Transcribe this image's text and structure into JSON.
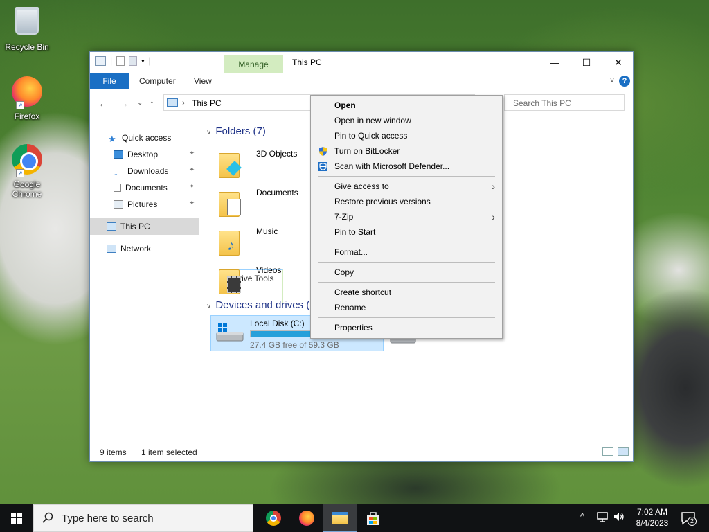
{
  "desktop": {
    "icons": [
      {
        "label": "Recycle Bin",
        "icon": "recycle-bin-icon"
      },
      {
        "label": "Firefox",
        "icon": "firefox-icon"
      },
      {
        "label": "Google Chrome",
        "icon": "chrome-icon"
      }
    ]
  },
  "window": {
    "title": "This PC",
    "context_tab": "Manage",
    "ribbon_tabs": [
      "File",
      "Computer",
      "View",
      "Drive Tools"
    ],
    "controls": {
      "minimize": "—",
      "maximize": "☐",
      "close": "✕"
    },
    "help": "?"
  },
  "address": {
    "crumb": "This PC",
    "separator": "›",
    "search_placeholder": "Search This PC"
  },
  "navpane": {
    "items": [
      {
        "label": "Quick access",
        "icon": "star-icon",
        "pinned": false
      },
      {
        "label": "Desktop",
        "icon": "desktop-folder-icon",
        "pinned": true
      },
      {
        "label": "Downloads",
        "icon": "download-arrow-icon",
        "pinned": true
      },
      {
        "label": "Documents",
        "icon": "document-icon",
        "pinned": true
      },
      {
        "label": "Pictures",
        "icon": "picture-icon",
        "pinned": true
      },
      {
        "label": "This PC",
        "icon": "computer-icon",
        "pinned": false,
        "selected": true
      },
      {
        "label": "Network",
        "icon": "network-icon",
        "pinned": false
      }
    ],
    "pin_glyph": "📌"
  },
  "content": {
    "folders_header": "Folders (7)",
    "folders": [
      "3D Objects",
      "Documents",
      "Music",
      "Videos"
    ],
    "drives_header": "Devices and drives (2",
    "drive": {
      "name": "Local Disk (C:)",
      "free_text": "27.4 GB free of 59.3 GB",
      "used_fraction": 0.54
    }
  },
  "status": {
    "items": "9 items",
    "selected": "1 item selected"
  },
  "context_menu": {
    "groups": [
      [
        {
          "label": "Open",
          "bold": true
        },
        {
          "label": "Open in new window"
        },
        {
          "label": "Pin to Quick access"
        },
        {
          "label": "Turn on BitLocker",
          "icon": "uac-shield-icon"
        },
        {
          "label": "Scan with Microsoft Defender...",
          "icon": "defender-icon"
        }
      ],
      [
        {
          "label": "Give access to",
          "submenu": true
        },
        {
          "label": "Restore previous versions"
        },
        {
          "label": "7-Zip",
          "submenu": true
        },
        {
          "label": "Pin to Start"
        }
      ],
      [
        {
          "label": "Format..."
        }
      ],
      [
        {
          "label": "Copy"
        }
      ],
      [
        {
          "label": "Create shortcut"
        },
        {
          "label": "Rename"
        }
      ],
      [
        {
          "label": "Properties"
        }
      ]
    ],
    "submenu_glyph": "›"
  },
  "taskbar": {
    "search_placeholder": "Type here to search",
    "apps": [
      "chrome-icon",
      "firefox-icon",
      "file-explorer-icon",
      "microsoft-store-icon"
    ],
    "time": "7:02 AM",
    "date": "8/4/2023",
    "notification_count": "2",
    "tray_chevron": "^"
  },
  "colors": {
    "accent": "#1a6fc4",
    "manage_tab": "#d3ecc0",
    "selection": "#cce8ff",
    "drive_bar": "#26a0da",
    "taskbar": "#101214"
  }
}
